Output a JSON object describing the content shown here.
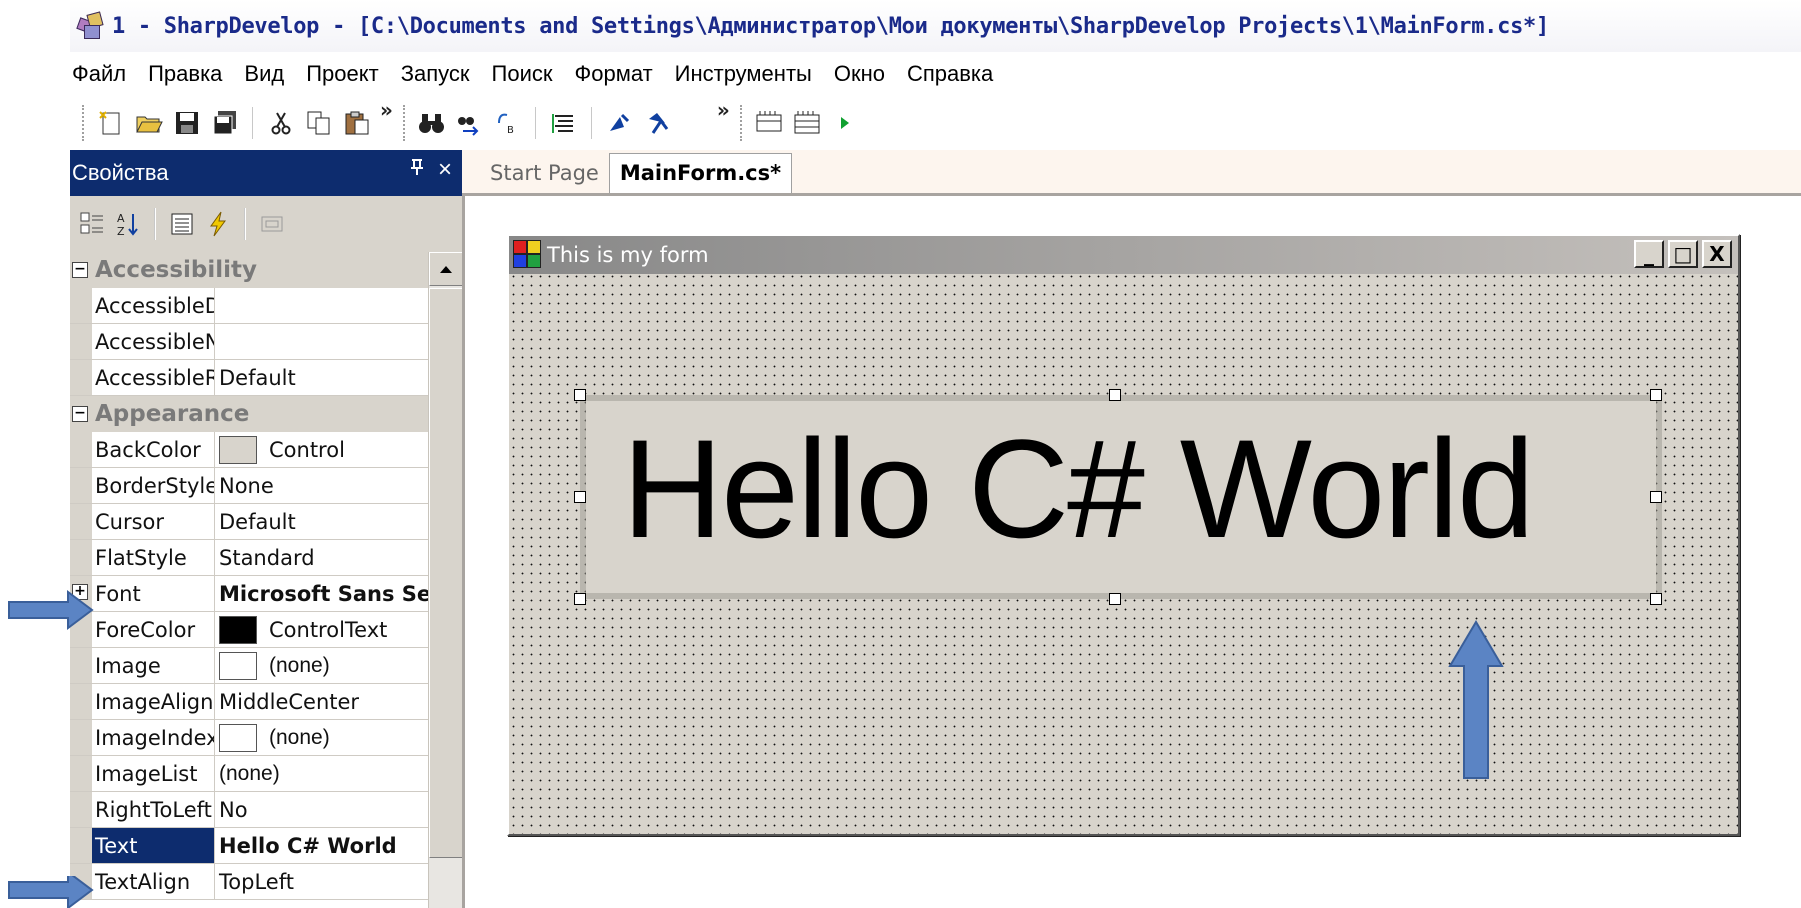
{
  "window": {
    "title": "1 - SharpDevelop - [C:\\Documents and Settings\\Администратор\\Мои документы\\SharpDevelop Projects\\1\\MainForm.cs*]"
  },
  "menu": [
    "Файл",
    "Правка",
    "Вид",
    "Проект",
    "Запуск",
    "Поиск",
    "Формат",
    "Инструменты",
    "Окно",
    "Справка"
  ],
  "properties_pad": {
    "title": "Свойства",
    "pin_glyph": "ᵖ",
    "close_glyph": "×",
    "categories": {
      "accessibility": "Accessibility",
      "appearance": "Appearance"
    },
    "rows": {
      "r1": {
        "name": "AccessibleD",
        "value": ""
      },
      "r2": {
        "name": "AccessibleN",
        "value": ""
      },
      "r3": {
        "name": "AccessibleR",
        "value": "Default"
      },
      "r4": {
        "name": "BackColor",
        "value": "Control"
      },
      "r5": {
        "name": "BorderStyle",
        "value": "None"
      },
      "r6": {
        "name": "Cursor",
        "value": "Default"
      },
      "r7": {
        "name": "FlatStyle",
        "value": "Standard"
      },
      "r8": {
        "name": "Font",
        "value": "Microsoft Sans Serif"
      },
      "r9": {
        "name": "ForeColor",
        "value": "ControlText"
      },
      "r10": {
        "name": "Image",
        "value": "(none)"
      },
      "r11": {
        "name": "ImageAlign",
        "value": "MiddleCenter"
      },
      "r12": {
        "name": "ImageIndex",
        "value": "(none)"
      },
      "r13": {
        "name": "ImageList",
        "value": "(none)"
      },
      "r14": {
        "name": "RightToLeft",
        "value": "No"
      },
      "r15": {
        "name": "Text",
        "value": "Hello C# World"
      },
      "r16": {
        "name": "TextAlign",
        "value": "TopLeft"
      }
    },
    "colors": {
      "backcolor_swatch": "#d8d4cc",
      "forecolor_swatch": "#000000",
      "image_swatch": "#ffffff"
    }
  },
  "tabs": {
    "start_page": "Start Page",
    "main_form": "MainForm.cs*"
  },
  "form": {
    "title": "This is my form",
    "minimize": "_",
    "maximize": "□",
    "close": "X",
    "label_text": "Hello C# World"
  },
  "colors": {
    "header_blue": "#0d2c6e",
    "form_bg": "#d8d4cc",
    "arrow_blue": "#5b84c4"
  }
}
